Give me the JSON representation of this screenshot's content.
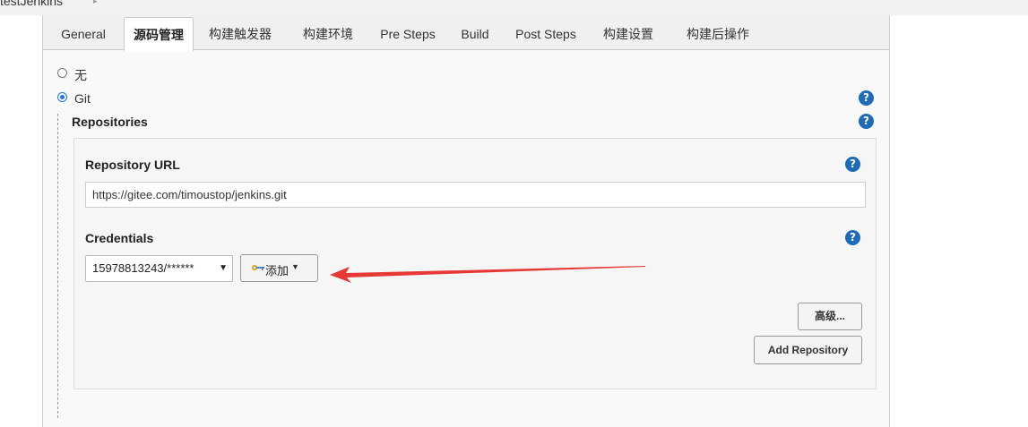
{
  "breadcrumb": {
    "job_name": "testJenkins",
    "arrow": "▸"
  },
  "tabs": [
    {
      "label": "General"
    },
    {
      "label": "源码管理"
    },
    {
      "label": "构建触发器"
    },
    {
      "label": "构建环境"
    },
    {
      "label": "Pre Steps"
    },
    {
      "label": "Build"
    },
    {
      "label": "Post Steps"
    },
    {
      "label": "构建设置"
    },
    {
      "label": "构建后操作"
    }
  ],
  "active_tab": "源码管理",
  "scm": {
    "options": [
      {
        "label": "无",
        "checked": false
      },
      {
        "label": "Git",
        "checked": true
      }
    ]
  },
  "repositories": {
    "section_label": "Repositories",
    "url_label": "Repository URL",
    "url_value": "https://gitee.com/timoustop/jenkins.git",
    "credentials_label": "Credentials",
    "credentials_selected": "15978813243/******",
    "add_button_label": "添加",
    "advanced_button_label": "高级...",
    "add_repository_label": "Add Repository"
  },
  "help_icon_glyph": "?",
  "colors": {
    "accent": "#1a73e8",
    "help_icon": "#1e6bb8",
    "annotation_arrow": "#e53935"
  }
}
